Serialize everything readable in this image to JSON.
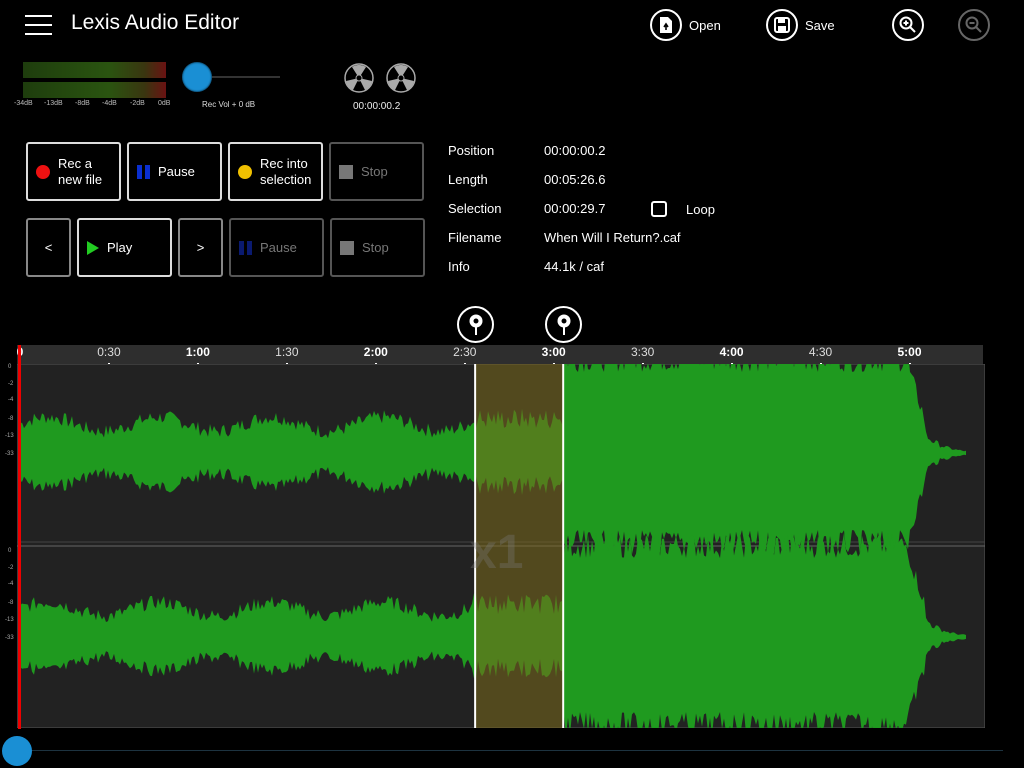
{
  "header": {
    "title": "Lexis Audio Editor",
    "open_label": "Open",
    "save_label": "Save"
  },
  "meters": {
    "tick_labels": [
      "-34dB",
      "-13dB",
      "-8dB",
      "-4dB",
      "-2dB",
      "0dB"
    ],
    "rec_vol_label": "Rec Vol + 0 dB",
    "reel_time": "00:00:00.2"
  },
  "record_buttons": {
    "rec_new_line1": "Rec a",
    "rec_new_line2": "new file",
    "pause": "Pause",
    "rec_into_line1": "Rec into",
    "rec_into_line2": "selection",
    "stop": "Stop"
  },
  "play_buttons": {
    "prev": "<",
    "play": "Play",
    "next": ">",
    "pause": "Pause",
    "stop": "Stop"
  },
  "info": {
    "position_label": "Position",
    "position_value": "00:00:00.2",
    "length_label": "Length",
    "length_value": "00:05:26.6",
    "selection_label": "Selection",
    "selection_value": "00:00:29.7",
    "loop_label": "Loop",
    "filename_label": "Filename",
    "filename_value": "When Will I Return?.caf",
    "info_label": "Info",
    "info_value": "44.1k / caf"
  },
  "timeline": {
    "labels": [
      "0",
      "0:30",
      "1:00",
      "1:30",
      "2:00",
      "2:30",
      "3:00",
      "3:30",
      "4:00",
      "4:30",
      "5:00"
    ],
    "bold": [
      true,
      false,
      true,
      false,
      true,
      false,
      true,
      false,
      true,
      false,
      true
    ],
    "total_seconds": 326.6,
    "selection_start_seconds": 153.5,
    "selection_end_seconds": 183.2,
    "playhead_seconds": 0.2
  },
  "waveform": {
    "db_labels": [
      "0",
      "-2",
      "-4",
      "-8",
      "-13",
      "-33"
    ],
    "zoom_label": "x1"
  },
  "colors": {
    "wave": "#1f9a1f",
    "selection_overlay": "#7a6a1c",
    "playhead": "#e00000",
    "accent_blue": "#1a8fd4"
  }
}
